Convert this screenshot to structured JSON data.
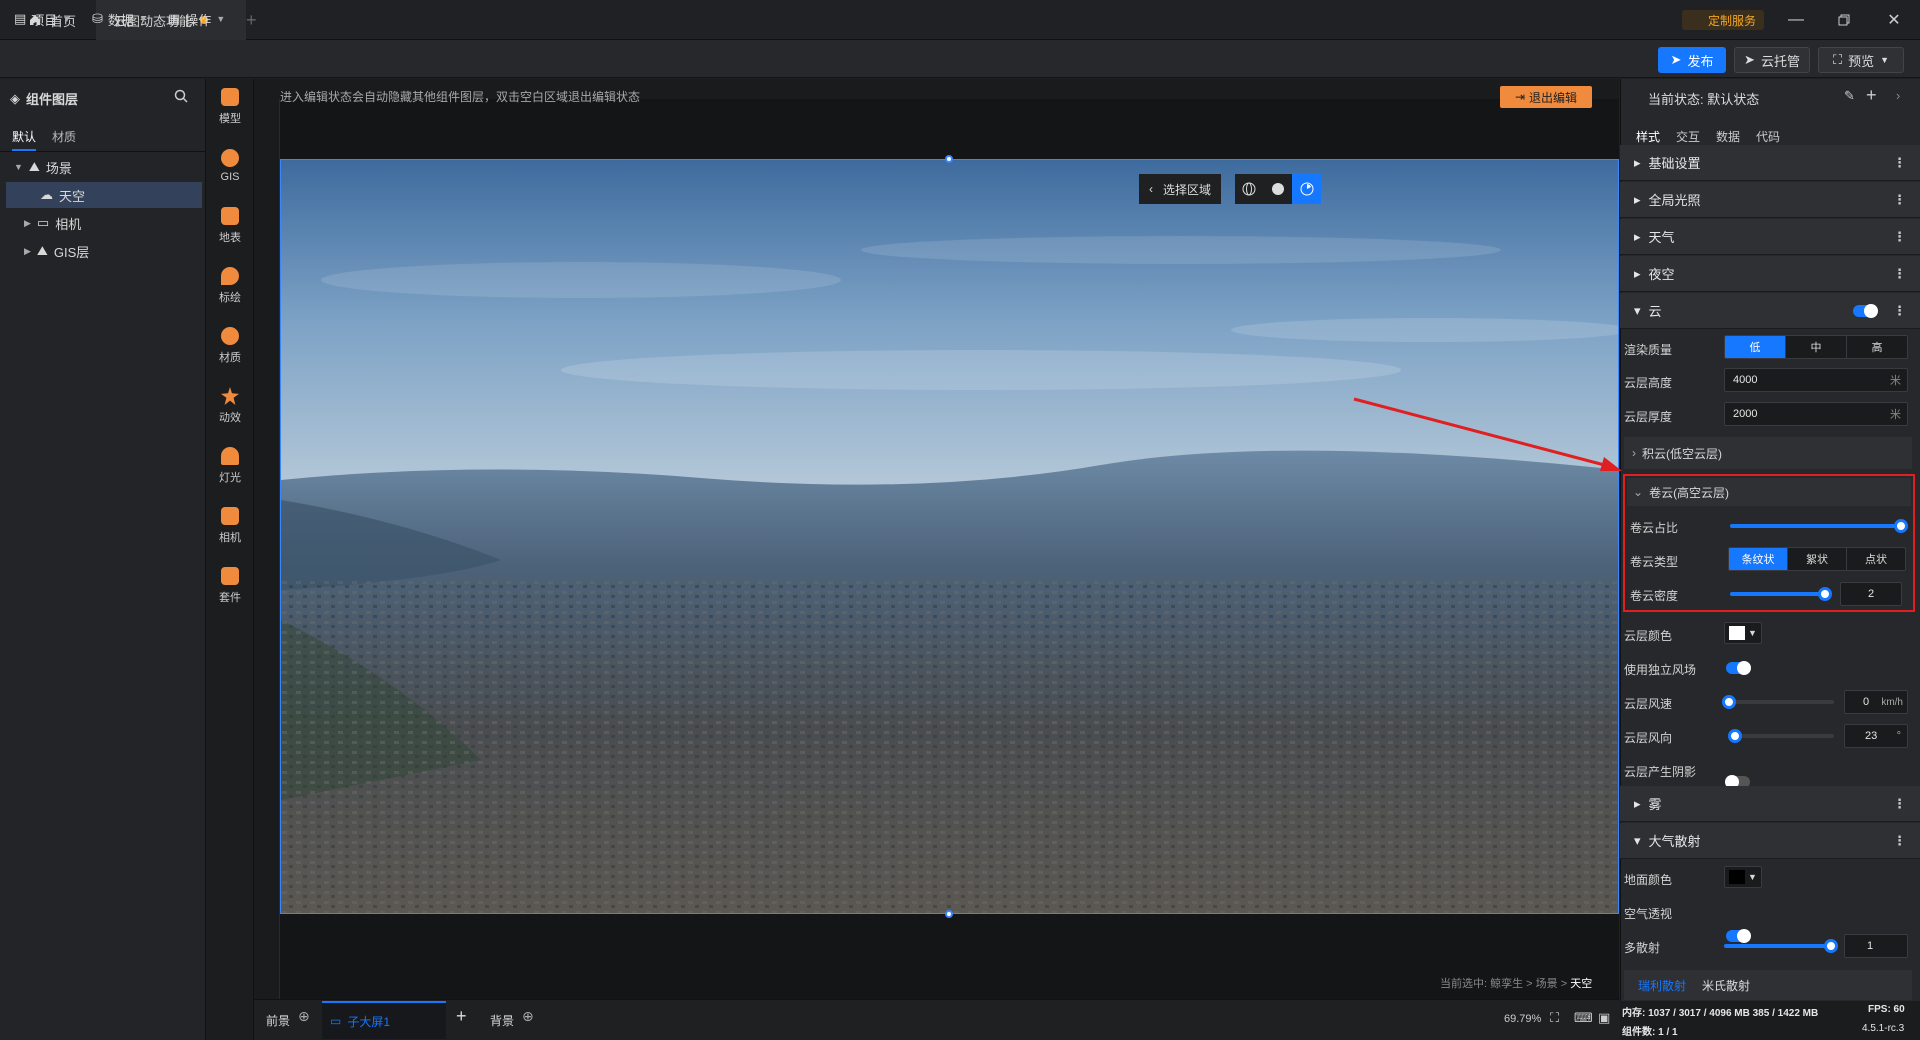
{
  "tabs": [
    {
      "label": "首页"
    },
    {
      "label": "云图动态功能"
    }
  ],
  "titlebar": {
    "service": "定制服务"
  },
  "menu": [
    {
      "label": "项目"
    },
    {
      "label": "数据"
    },
    {
      "label": "操作"
    }
  ],
  "toolbar": {
    "publish": "发布",
    "hosting": "云托管",
    "preview": "预览"
  },
  "left": {
    "title": "组件图层",
    "subtabs": [
      "默认",
      "材质"
    ],
    "tree": [
      {
        "label": "场景"
      },
      {
        "label": "天空"
      },
      {
        "label": "相机"
      },
      {
        "label": "GIS层"
      }
    ]
  },
  "tools": [
    {
      "label": "模型"
    },
    {
      "label": "GIS"
    },
    {
      "label": "地表"
    },
    {
      "label": "标绘"
    },
    {
      "label": "材质"
    },
    {
      "label": "动效"
    },
    {
      "label": "灯光"
    },
    {
      "label": "相机"
    },
    {
      "label": "套件"
    }
  ],
  "canvas": {
    "hint": "进入编辑状态会自动隐藏其他组件图层，双击空白区域退出编辑状态",
    "exit_edit": "退出编辑",
    "select_region": "选择区域",
    "breadcrumb_prefix": "当前选中: 鲸孪生 > 场景 >",
    "breadcrumb_current": "天空"
  },
  "bottom": {
    "front": "前景",
    "screen": "子大屏1",
    "back": "背景",
    "zoom": "69.79%"
  },
  "right": {
    "state_label": "当前状态: 默认状态",
    "tabs": [
      "样式",
      "交互",
      "数据",
      "代码"
    ],
    "sections": {
      "basic": "基础设置",
      "global_light": "全局光照",
      "weather": "天气",
      "night": "夜空",
      "cloud": "云",
      "fog": "雾",
      "atmo": "大气散射"
    },
    "render_quality": {
      "label": "渲染质量",
      "options": [
        "低",
        "中",
        "高"
      ],
      "selected": "低"
    },
    "cloud_height": {
      "label": "云层高度",
      "value": "4000",
      "unit": "米"
    },
    "cloud_thickness": {
      "label": "云层厚度",
      "value": "2000",
      "unit": "米"
    },
    "cumulus": "积云(低空云层)",
    "cirrus": {
      "title": "卷云(高空云层)",
      "ratio_label": "卷云占比",
      "ratio_value": 1.0,
      "type_label": "卷云类型",
      "types": [
        "条纹状",
        "絮状",
        "点状"
      ],
      "type_selected": "条纹状",
      "density_label": "卷云密度",
      "density_value": "2"
    },
    "cloud_color": "云层颜色",
    "independent_wind": "使用独立风场",
    "wind_speed": {
      "label": "云层风速",
      "value": "0",
      "unit": "km/h"
    },
    "wind_dir": {
      "label": "云层风向",
      "value": "23",
      "unit": "°"
    },
    "shadow": "云层产生阴影",
    "ground_color": "地面颜色",
    "aerial": "空气透视",
    "multi_scatter": {
      "label": "多散射",
      "value": "1"
    },
    "scatter_tabs": [
      "瑞利散射",
      "米氏散射"
    ]
  },
  "status": {
    "memory": "内存: 1037 / 3017 / 4096 MB  385 / 1422 MB",
    "fps": "FPS: 60",
    "components": "组件数: 1 / 1",
    "version": "4.5.1-rc.3"
  },
  "colors": {
    "accent": "#1677ff",
    "warning": "#f5a623",
    "highlight": "#e02020"
  }
}
